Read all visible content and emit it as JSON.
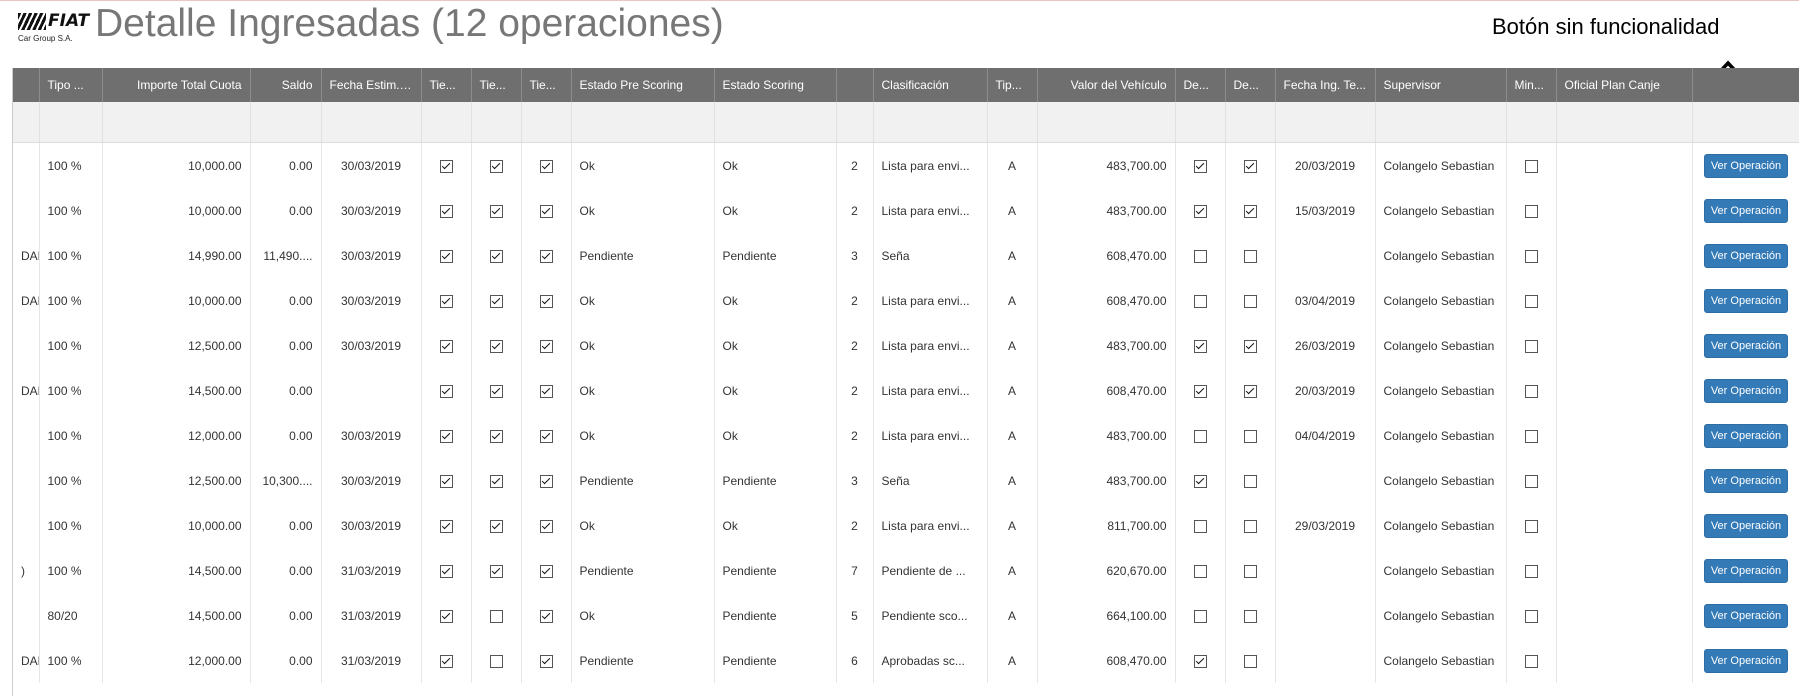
{
  "logo": {
    "brand": "FIAT",
    "subtitle": "Car Group S.A."
  },
  "page_title": "Detalle Ingresadas (12 operaciones)",
  "annotation": "Botón sin funcionalidad",
  "table": {
    "headers": [
      "",
      "Tipo ...",
      "Importe Total Cuota",
      "Saldo",
      "Fecha Estim. ...",
      "Tie...",
      "Tie...",
      "Tie...",
      "Estado Pre Scoring",
      "Estado Scoring",
      "",
      "Clasificación",
      "Tip...",
      "Valor del Vehículo",
      "De...",
      "De...",
      "Fecha Ing. Te...",
      "Supervisor",
      "Min...",
      "Oficial Plan Canje",
      ""
    ],
    "button_label": "Ver Operación",
    "rows": [
      {
        "c0": "",
        "tipo": "100 %",
        "importe": "10,000.00",
        "saldo": "0.00",
        "fecha": "30/03/2019",
        "t1": true,
        "t2": true,
        "t3": true,
        "pre": "Ok",
        "scoring": "Ok",
        "num": "2",
        "clas": "Lista para envi...",
        "tip": "A",
        "valor": "483,700.00",
        "d1": true,
        "d2": true,
        "fing": "20/03/2019",
        "sup": "Colangelo Sebastian",
        "min": false,
        "oficial": ""
      },
      {
        "c0": "",
        "tipo": "100 %",
        "importe": "10,000.00",
        "saldo": "0.00",
        "fecha": "30/03/2019",
        "t1": true,
        "t2": true,
        "t3": true,
        "pre": "Ok",
        "scoring": "Ok",
        "num": "2",
        "clas": "Lista para envi...",
        "tip": "A",
        "valor": "483,700.00",
        "d1": true,
        "d2": true,
        "fing": "15/03/2019",
        "sup": "Colangelo Sebastian",
        "min": false,
        "oficial": ""
      },
      {
        "c0": "DAD",
        "tipo": "100 %",
        "importe": "14,990.00",
        "saldo": "11,490....",
        "fecha": "30/03/2019",
        "t1": true,
        "t2": true,
        "t3": true,
        "pre": "Pendiente",
        "scoring": "Pendiente",
        "num": "3",
        "clas": "Seña",
        "tip": "A",
        "valor": "608,470.00",
        "d1": false,
        "d2": false,
        "fing": "",
        "sup": "Colangelo Sebastian",
        "min": false,
        "oficial": ""
      },
      {
        "c0": "DAD",
        "tipo": "100 %",
        "importe": "10,000.00",
        "saldo": "0.00",
        "fecha": "30/03/2019",
        "t1": true,
        "t2": true,
        "t3": true,
        "pre": "Ok",
        "scoring": "Ok",
        "num": "2",
        "clas": "Lista para envi...",
        "tip": "A",
        "valor": "608,470.00",
        "d1": false,
        "d2": false,
        "fing": "03/04/2019",
        "sup": "Colangelo Sebastian",
        "min": false,
        "oficial": ""
      },
      {
        "c0": "",
        "tipo": "100 %",
        "importe": "12,500.00",
        "saldo": "0.00",
        "fecha": "30/03/2019",
        "t1": true,
        "t2": true,
        "t3": true,
        "pre": "Ok",
        "scoring": "Ok",
        "num": "2",
        "clas": "Lista para envi...",
        "tip": "A",
        "valor": "483,700.00",
        "d1": true,
        "d2": true,
        "fing": "26/03/2019",
        "sup": "Colangelo Sebastian",
        "min": false,
        "oficial": ""
      },
      {
        "c0": "DAD",
        "tipo": "100 %",
        "importe": "14,500.00",
        "saldo": "0.00",
        "fecha": "",
        "t1": true,
        "t2": true,
        "t3": true,
        "pre": "Ok",
        "scoring": "Ok",
        "num": "2",
        "clas": "Lista para envi...",
        "tip": "A",
        "valor": "608,470.00",
        "d1": true,
        "d2": true,
        "fing": "20/03/2019",
        "sup": "Colangelo Sebastian",
        "min": false,
        "oficial": ""
      },
      {
        "c0": "",
        "tipo": "100 %",
        "importe": "12,000.00",
        "saldo": "0.00",
        "fecha": "30/03/2019",
        "t1": true,
        "t2": true,
        "t3": true,
        "pre": "Ok",
        "scoring": "Ok",
        "num": "2",
        "clas": "Lista para envi...",
        "tip": "A",
        "valor": "483,700.00",
        "d1": false,
        "d2": false,
        "fing": "04/04/2019",
        "sup": "Colangelo Sebastian",
        "min": false,
        "oficial": ""
      },
      {
        "c0": "",
        "tipo": "100 %",
        "importe": "12,500.00",
        "saldo": "10,300....",
        "fecha": "30/03/2019",
        "t1": true,
        "t2": true,
        "t3": true,
        "pre": "Pendiente",
        "scoring": "Pendiente",
        "num": "3",
        "clas": "Seña",
        "tip": "A",
        "valor": "483,700.00",
        "d1": true,
        "d2": false,
        "fing": "",
        "sup": "Colangelo Sebastian",
        "min": false,
        "oficial": ""
      },
      {
        "c0": "",
        "tipo": "100 %",
        "importe": "10,000.00",
        "saldo": "0.00",
        "fecha": "30/03/2019",
        "t1": true,
        "t2": true,
        "t3": true,
        "pre": "Ok",
        "scoring": "Ok",
        "num": "2",
        "clas": "Lista para envi...",
        "tip": "A",
        "valor": "811,700.00",
        "d1": false,
        "d2": false,
        "fing": "29/03/2019",
        "sup": "Colangelo Sebastian",
        "min": false,
        "oficial": ""
      },
      {
        "c0": ")",
        "tipo": "100 %",
        "importe": "14,500.00",
        "saldo": "0.00",
        "fecha": "31/03/2019",
        "t1": true,
        "t2": true,
        "t3": true,
        "pre": "Pendiente",
        "scoring": "Pendiente",
        "num": "7",
        "clas": "Pendiente de ...",
        "tip": "A",
        "valor": "620,670.00",
        "d1": false,
        "d2": false,
        "fing": "",
        "sup": "Colangelo Sebastian",
        "min": false,
        "oficial": ""
      },
      {
        "c0": "",
        "tipo": "80/20",
        "importe": "14,500.00",
        "saldo": "0.00",
        "fecha": "31/03/2019",
        "t1": true,
        "t2": false,
        "t3": true,
        "pre": "Ok",
        "scoring": "Pendiente",
        "num": "5",
        "clas": "Pendiente sco...",
        "tip": "A",
        "valor": "664,100.00",
        "d1": false,
        "d2": false,
        "fing": "",
        "sup": "Colangelo Sebastian",
        "min": false,
        "oficial": ""
      },
      {
        "c0": "DAD",
        "tipo": "100 %",
        "importe": "12,000.00",
        "saldo": "0.00",
        "fecha": "31/03/2019",
        "t1": true,
        "t2": false,
        "t3": true,
        "pre": "Pendiente",
        "scoring": "Pendiente",
        "num": "6",
        "clas": "Aprobadas sc...",
        "tip": "A",
        "valor": "608,470.00",
        "d1": true,
        "d2": false,
        "fing": "",
        "sup": "Colangelo Sebastian",
        "min": false,
        "oficial": ""
      }
    ]
  }
}
